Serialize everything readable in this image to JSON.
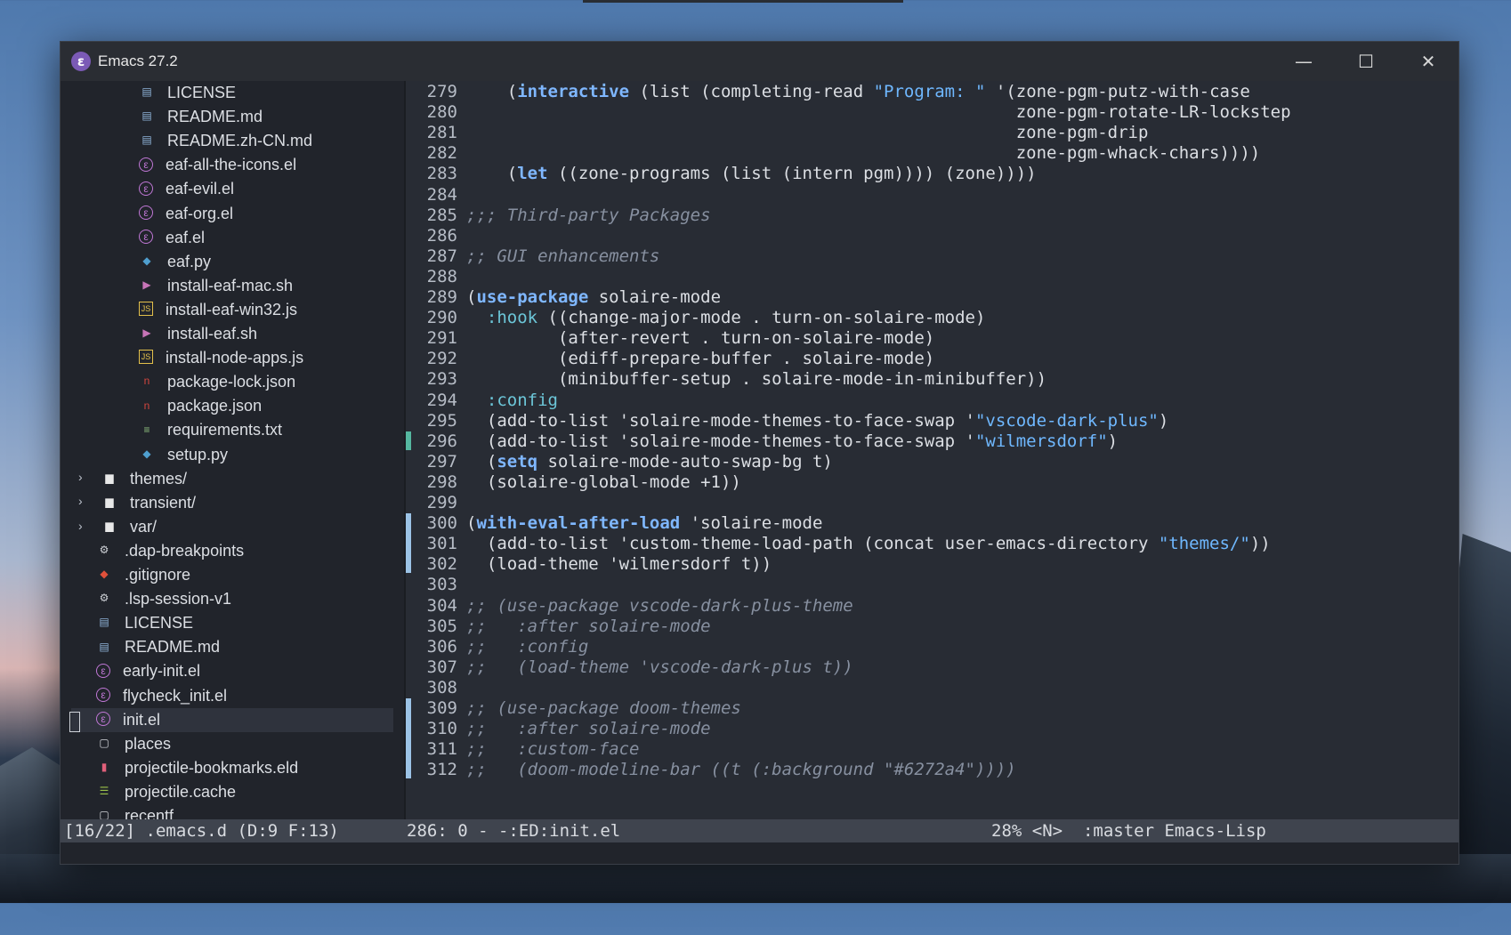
{
  "window": {
    "title": "Emacs 27.2",
    "app_icon_glyph": "ε"
  },
  "controls": {
    "minimize": "—",
    "maximize": "☐",
    "close": "✕"
  },
  "tree": [
    {
      "label": "LICENSE",
      "icon": "book-icon",
      "color": "#8fb3d9",
      "indent": 2
    },
    {
      "label": "README.md",
      "icon": "book-icon",
      "color": "#8fb3d9",
      "indent": 2
    },
    {
      "label": "README.zh-CN.md",
      "icon": "book-icon",
      "color": "#8fb3d9",
      "indent": 2
    },
    {
      "label": "eaf-all-the-icons.el",
      "icon": "emacs-icon",
      "color": "#c077d6",
      "indent": 2
    },
    {
      "label": "eaf-evil.el",
      "icon": "emacs-icon",
      "color": "#c077d6",
      "indent": 2
    },
    {
      "label": "eaf-org.el",
      "icon": "emacs-icon",
      "color": "#c077d6",
      "indent": 2
    },
    {
      "label": "eaf.el",
      "icon": "emacs-icon",
      "color": "#c077d6",
      "indent": 2
    },
    {
      "label": "eaf.py",
      "icon": "python-icon",
      "color": "#4f9fcf",
      "indent": 2
    },
    {
      "label": "install-eaf-mac.sh",
      "icon": "terminal-icon",
      "color": "#c774b7",
      "indent": 2
    },
    {
      "label": "install-eaf-win32.js",
      "icon": "js-icon",
      "color": "#e3c04b",
      "indent": 2
    },
    {
      "label": "install-eaf.sh",
      "icon": "terminal-icon",
      "color": "#c774b7",
      "indent": 2
    },
    {
      "label": "install-node-apps.js",
      "icon": "js-icon",
      "color": "#e3c04b",
      "indent": 2
    },
    {
      "label": "package-lock.json",
      "icon": "npm-icon",
      "color": "#d0453e",
      "indent": 2
    },
    {
      "label": "package.json",
      "icon": "npm-icon",
      "color": "#d0453e",
      "indent": 2
    },
    {
      "label": "requirements.txt",
      "icon": "text-file-icon",
      "color": "#8fbf7f",
      "indent": 2
    },
    {
      "label": "setup.py",
      "icon": "python-icon",
      "color": "#4f9fcf",
      "indent": 2
    },
    {
      "label": "themes/",
      "icon": "folder-icon",
      "color": "#e8e8e8",
      "indent": 1,
      "folder": true
    },
    {
      "label": "transient/",
      "icon": "folder-icon",
      "color": "#e8e8e8",
      "indent": 1,
      "folder": true
    },
    {
      "label": "var/",
      "icon": "folder-icon",
      "color": "#e8e8e8",
      "indent": 1,
      "folder": true
    },
    {
      "label": ".dap-breakpoints",
      "icon": "gear-icon",
      "color": "#d0d3d8",
      "indent": 1
    },
    {
      "label": ".gitignore",
      "icon": "git-icon",
      "color": "#e0503a",
      "indent": 1
    },
    {
      "label": ".lsp-session-v1",
      "icon": "gear-icon",
      "color": "#d0d3d8",
      "indent": 1
    },
    {
      "label": "LICENSE",
      "icon": "book-icon",
      "color": "#8fb3d9",
      "indent": 1
    },
    {
      "label": "README.md",
      "icon": "book-icon",
      "color": "#8fb3d9",
      "indent": 1
    },
    {
      "label": "early-init.el",
      "icon": "emacs-icon",
      "color": "#c077d6",
      "indent": 1
    },
    {
      "label": "flycheck_init.el",
      "icon": "emacs-icon",
      "color": "#c077d6",
      "indent": 1
    },
    {
      "label": "init.el",
      "icon": "emacs-icon",
      "color": "#c077d6",
      "indent": 1,
      "active": true
    },
    {
      "label": "places",
      "icon": "file-icon",
      "color": "#d0d3d8",
      "indent": 1
    },
    {
      "label": "projectile-bookmarks.eld",
      "icon": "bookmark-icon",
      "color": "#e0607a",
      "indent": 1
    },
    {
      "label": "projectile.cache",
      "icon": "database-icon",
      "color": "#9bc04a",
      "indent": 1
    },
    {
      "label": "recentf",
      "icon": "file-icon",
      "color": "#d0d3d8",
      "indent": 1
    }
  ],
  "code": [
    {
      "n": "279",
      "segs": [
        [
          "    (",
          ""
        ],
        [
          "interactive",
          "kw"
        ],
        [
          " (list (completing-read ",
          ""
        ],
        [
          "\"Program: \"",
          "st"
        ],
        [
          " '(zone-pgm-putz-with-case",
          ""
        ]
      ]
    },
    {
      "n": "280",
      "segs": [
        [
          "                                                      zone-pgm-rotate-LR-lockstep",
          ""
        ]
      ]
    },
    {
      "n": "281",
      "segs": [
        [
          "                                                      zone-pgm-drip",
          ""
        ]
      ]
    },
    {
      "n": "282",
      "segs": [
        [
          "                                                      zone-pgm-whack-chars))))",
          ""
        ]
      ]
    },
    {
      "n": "283",
      "segs": [
        [
          "    (",
          ""
        ],
        [
          "let",
          "kw"
        ],
        [
          " ((zone-programs (list (intern pgm)))) (zone))))",
          ""
        ]
      ]
    },
    {
      "n": "284",
      "segs": []
    },
    {
      "n": "285",
      "segs": [
        [
          ";;; Third-party Packages",
          "cm"
        ]
      ]
    },
    {
      "n": "286",
      "segs": []
    },
    {
      "n": "287",
      "segs": [
        [
          ";; GUI enhancements",
          "cm"
        ]
      ]
    },
    {
      "n": "288",
      "segs": []
    },
    {
      "n": "289",
      "segs": [
        [
          "(",
          ""
        ],
        [
          "use-package",
          "kw"
        ],
        [
          " solaire-mode",
          ""
        ]
      ]
    },
    {
      "n": "290",
      "segs": [
        [
          "  ",
          ""
        ],
        [
          ":hook",
          "key"
        ],
        [
          " ((change-major-mode . turn-on-solaire-mode)",
          ""
        ]
      ]
    },
    {
      "n": "291",
      "segs": [
        [
          "         (after-revert . turn-on-solaire-mode)",
          ""
        ]
      ]
    },
    {
      "n": "292",
      "segs": [
        [
          "         (ediff-prepare-buffer . solaire-mode)",
          ""
        ]
      ]
    },
    {
      "n": "293",
      "segs": [
        [
          "         (minibuffer-setup . solaire-mode-in-minibuffer))",
          ""
        ]
      ]
    },
    {
      "n": "294",
      "segs": [
        [
          "  ",
          ""
        ],
        [
          ":config",
          "key"
        ]
      ]
    },
    {
      "n": "295",
      "segs": [
        [
          "  (add-to-list 'solaire-mode-themes-to-face-swap '",
          ""
        ],
        [
          "\"vscode-dark-plus\"",
          "st"
        ],
        [
          ")",
          ""
        ]
      ]
    },
    {
      "n": "296",
      "segs": [
        [
          "  (add-to-list 'solaire-mode-themes-to-face-swap '",
          ""
        ],
        [
          "\"wilmersdorf\"",
          "st"
        ],
        [
          ")",
          ""
        ]
      ]
    },
    {
      "n": "297",
      "segs": [
        [
          "  (",
          ""
        ],
        [
          "setq",
          "kw"
        ],
        [
          " solaire-mode-auto-swap-bg t)",
          ""
        ]
      ]
    },
    {
      "n": "298",
      "segs": [
        [
          "  (solaire-global-mode +1))",
          ""
        ]
      ]
    },
    {
      "n": "299",
      "segs": []
    },
    {
      "n": "300",
      "segs": [
        [
          "(",
          ""
        ],
        [
          "with-eval-after-load",
          "kw"
        ],
        [
          " 'solaire-mode",
          ""
        ]
      ]
    },
    {
      "n": "301",
      "segs": [
        [
          "  (add-to-list 'custom-theme-load-path (concat user-emacs-directory ",
          ""
        ],
        [
          "\"themes/\"",
          "st"
        ],
        [
          "))",
          ""
        ]
      ]
    },
    {
      "n": "302",
      "segs": [
        [
          "  (load-theme 'wilmersdorf t))",
          ""
        ]
      ]
    },
    {
      "n": "303",
      "segs": []
    },
    {
      "n": "304",
      "segs": [
        [
          ";; (use-package vscode-dark-plus-theme",
          "cm"
        ]
      ]
    },
    {
      "n": "305",
      "segs": [
        [
          ";;   :after solaire-mode",
          "cm"
        ]
      ]
    },
    {
      "n": "306",
      "segs": [
        [
          ";;   :config",
          "cm"
        ]
      ]
    },
    {
      "n": "307",
      "segs": [
        [
          ";;   (load-theme 'vscode-dark-plus t))",
          "cm"
        ]
      ]
    },
    {
      "n": "308",
      "segs": []
    },
    {
      "n": "309",
      "segs": [
        [
          ";; (use-package doom-themes",
          "cm"
        ]
      ]
    },
    {
      "n": "310",
      "segs": [
        [
          ";;   :after solaire-mode",
          "cm"
        ]
      ]
    },
    {
      "n": "311",
      "segs": [
        [
          ";;   :custom-face",
          "cm"
        ]
      ]
    },
    {
      "n": "312",
      "segs": [
        [
          ";;   (doom-modeline-bar ((t (:background \"#6272a4\"))))",
          "cm"
        ]
      ]
    }
  ],
  "fringe_marks": [
    {
      "line": "296",
      "color": "#55b7a0"
    },
    {
      "line": "300",
      "color": "#9cc3e6",
      "span": 3
    },
    {
      "line": "309",
      "color": "#9cc3e6",
      "span": 4
    }
  ],
  "modeline": {
    "left": "[16/22] .emacs.d (D:9 F:13)",
    "buffer": "286: 0 - -:ED:init.el",
    "right": "28% <N>  :master Emacs-Lisp"
  }
}
